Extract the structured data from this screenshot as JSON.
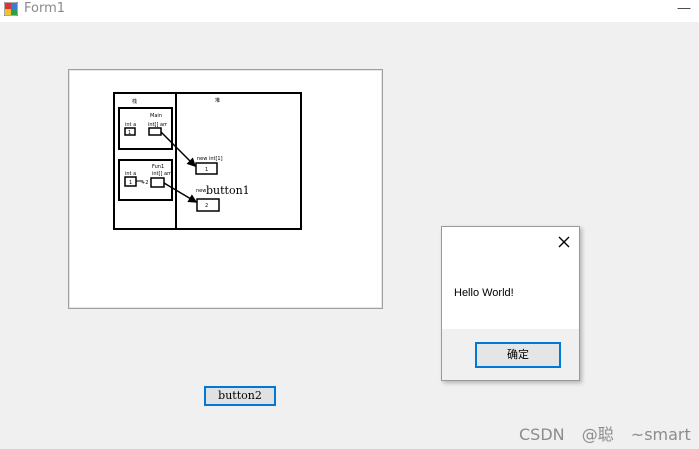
{
  "window": {
    "title": "Form1",
    "minimize_glyph": "—"
  },
  "picture": {
    "stack_label": "栈",
    "heap_label": "堆",
    "main_label": "Main",
    "fun_label": "Fun1",
    "int_a_1": "int a",
    "int_arr_1": "int[] arr",
    "int_a_2": "int a",
    "int_arr_2": "int[] arr",
    "val_a_1": "1",
    "val_a_2": "1",
    "heap_new_1": "new int[1]",
    "heap_val_1": "1",
    "heap_new_2": "new",
    "heap_val_2": "2",
    "arrow_sum": "+2"
  },
  "button1": {
    "label": "button1"
  },
  "button2": {
    "label": "button2"
  },
  "messagebox": {
    "message": "Hello World!",
    "ok_label": "确定"
  },
  "watermark": {
    "text": "CSDN @聪 ~smart"
  },
  "colors": {
    "accent": "#0078d7",
    "background": "#f0f0f0"
  }
}
